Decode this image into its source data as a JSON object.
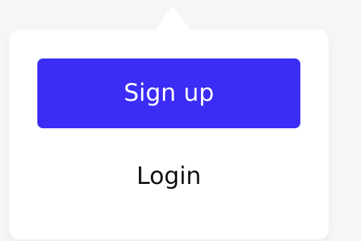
{
  "auth_menu": {
    "signup_label": "Sign up",
    "login_label": "Login"
  },
  "colors": {
    "primary": "#3b2cf6",
    "menu_background": "#ffffff",
    "page_background": "#f6f6f8",
    "text": "#111111"
  }
}
